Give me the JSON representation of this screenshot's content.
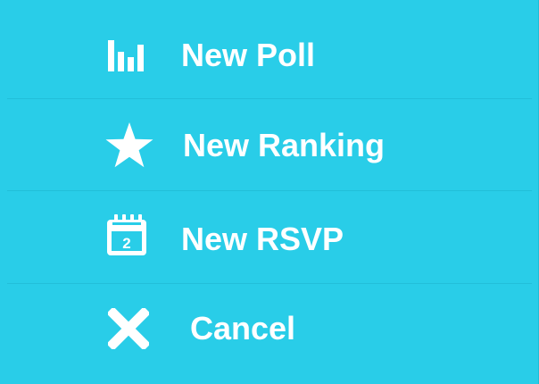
{
  "menu": {
    "items": [
      {
        "label": "New Poll",
        "icon": "bar-chart-icon"
      },
      {
        "label": "New Ranking",
        "icon": "star-icon"
      },
      {
        "label": "New RSVP",
        "icon": "calendar-icon",
        "calendar_day": "2"
      },
      {
        "label": "Cancel",
        "icon": "close-icon"
      }
    ]
  },
  "colors": {
    "background": "#29cde8",
    "divider": "#22bfd9",
    "foreground": "#ffffff"
  }
}
